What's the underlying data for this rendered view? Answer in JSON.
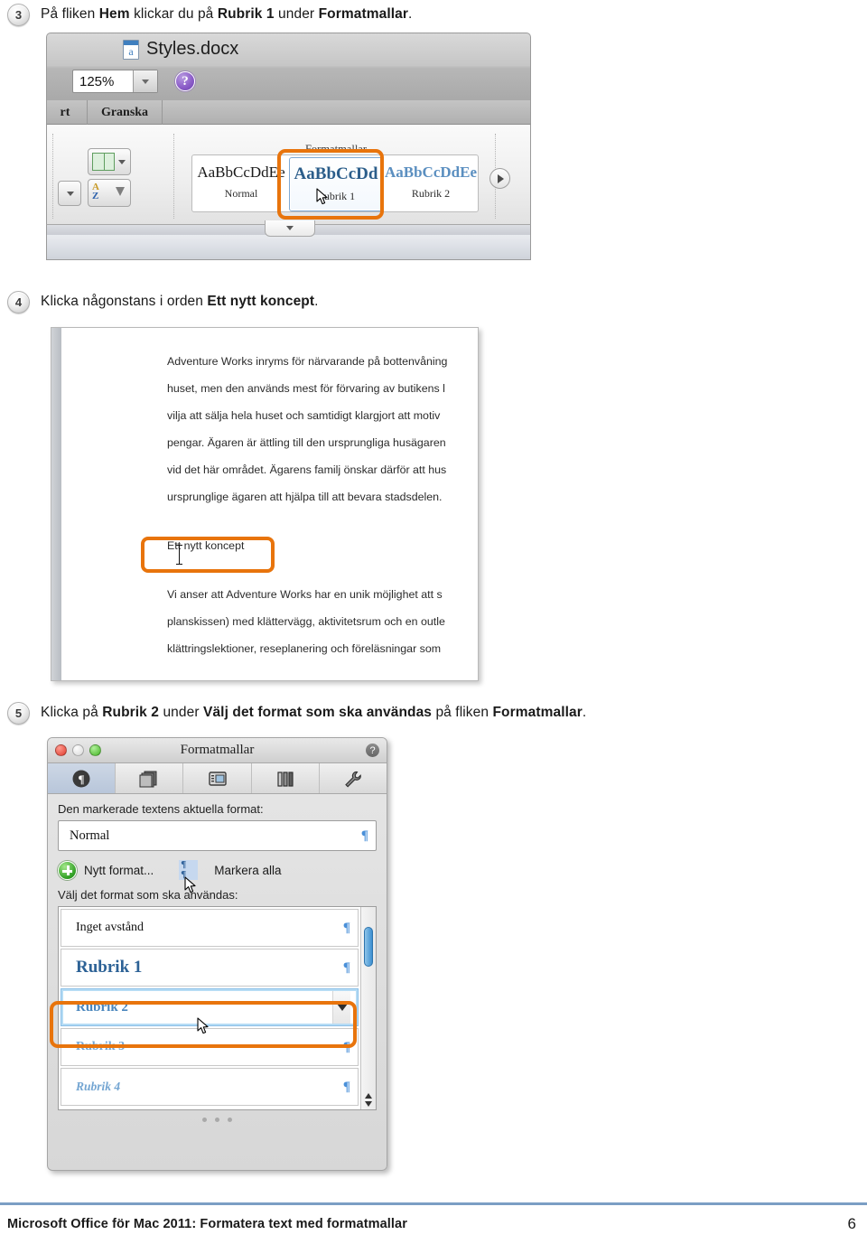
{
  "steps": [
    {
      "number": "3",
      "text_parts": [
        "På fliken ",
        "Hem",
        " klickar du på ",
        "Rubrik 1",
        " under ",
        "Formatmallar",
        "."
      ],
      "plain": "På fliken Hem klickar du på Rubrik 1 under Formatmallar."
    },
    {
      "number": "4",
      "plain": "Klicka någonstans i orden Ett nytt koncept."
    },
    {
      "number": "5",
      "plain": "Klicka på Rubrik 2 under Välj det format som ska användas på fliken Formatmallar."
    }
  ],
  "step3": {
    "number": "3",
    "lead": "På fliken ",
    "bold1": "Hem",
    "mid1": " klickar du på ",
    "bold2": "Rubrik 1",
    "mid2": " under ",
    "bold3": "Formatmallar",
    "tail": "."
  },
  "step4": {
    "number": "4",
    "lead": "Klicka någonstans i orden ",
    "bold1": "Ett nytt koncept",
    "tail": "."
  },
  "step5": {
    "number": "5",
    "lead": "Klicka på ",
    "bold1": "Rubrik 2",
    "mid1": " under ",
    "bold2": "Välj det format som ska användas",
    "mid2": " på fliken ",
    "bold3": "Formatmallar",
    "tail": "."
  },
  "shot1": {
    "document_title": "Styles.docx",
    "document_icon_letter": "a",
    "zoom_value": "125%",
    "help_label": "?",
    "tabs": [
      "rt",
      "Granska"
    ],
    "group_label": "Formatmallar",
    "styles": [
      {
        "sample": "AaBbCcDdEe",
        "name": "Normal"
      },
      {
        "sample": "AaBbCcDd",
        "name": "Rubrik 1"
      },
      {
        "sample": "AaBbCcDdEe",
        "name": "Rubrik 2"
      }
    ],
    "sort_icon_letters": [
      "A",
      "Z"
    ],
    "highlight_color": "#e8740c"
  },
  "shot2": {
    "lines": [
      "Adventure Works inryms för närvarande på bottenvåning",
      "huset, men den används mest för förvaring av butikens l",
      "vilja att sälja hela huset och samtidigt klargjort att motiv",
      "pengar. Ägaren är ättling till den ursprungliga husägaren",
      "vid det här området. Ägarens familj önskar därför att hus",
      "ursprunglige ägaren att hjälpa till att bevara stadsdelen."
    ],
    "highlighted_text": "Ett nytt koncept",
    "lines_after": [
      "Vi anser att Adventure Works har en unik möjlighet att s",
      "planskissen) med klättervägg, aktivitetsrum och en outle",
      "klättringslektioner, reseplanering och föreläsningar som"
    ],
    "highlight_color": "#e8740c"
  },
  "shot3": {
    "window_title": "Formatmallar",
    "help_label": "?",
    "toolbar_icons": [
      "pilcrow-styles-icon",
      "document-elements-icon",
      "quick-tables-icon",
      "charts-icon",
      "toolbox-settings-icon"
    ],
    "current_format_label": "Den markerade textens aktuella format:",
    "current_format_value": "Normal",
    "new_format_label": "Nytt format...",
    "select_all_label": "Markera alla",
    "list_label": "Välj det format som ska användas:",
    "styles": [
      {
        "name": "Inget avstånd",
        "kind": "plain"
      },
      {
        "name": "Rubrik 1",
        "kind": "h1"
      },
      {
        "name": "Rubrik 2",
        "kind": "h2",
        "selected": true
      },
      {
        "name": "Rubrik 3",
        "kind": "h3"
      },
      {
        "name": "Rubrik 4",
        "kind": "h4"
      }
    ],
    "pilcrow_glyph": "¶",
    "highlight_color": "#e8740c"
  },
  "footer": {
    "text": "Microsoft Office för Mac 2011: Formatera text med formatmallar",
    "page": "6",
    "rule_color": "#7b9ec4"
  }
}
